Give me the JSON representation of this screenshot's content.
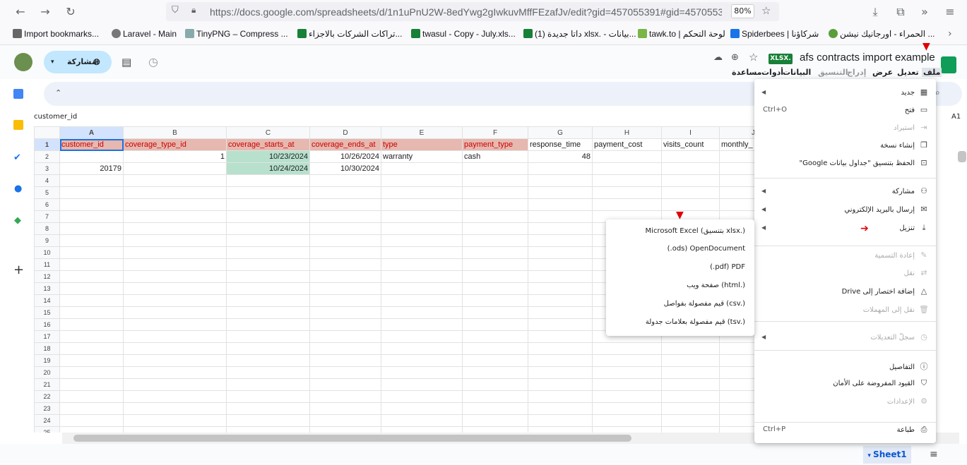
{
  "browser": {
    "url": "https://docs.google.com/spreadsheets/d/1n1uPnU2W-8edYwg2gIwkuvMffFEzafJv/edit?gid=457055391#gid=4570553",
    "zoom": "80%"
  },
  "bookmarks": [
    "Import bookmarks...",
    "Laravel - Main",
    "TinyPNG – Compress ...",
    "تراكات الشركات بالاجزاء...",
    "twasul - Copy - July.xls...",
    "داتا جديدة (1) xlsx. - بيانات...",
    "tawk.to | لوحة التحكم",
    "Spiderbees | شركاؤنا",
    "الحمراء - اورجانيك نيشن ..."
  ],
  "doc": {
    "title": "afs contracts import example",
    "badge": "XLSX.",
    "share_label": "مشاركة",
    "menus": [
      "ملف",
      "تعديل",
      "عرض",
      "إدراج",
      "التنسيق",
      "البيانات",
      "أدوات",
      "مساعدة"
    ]
  },
  "namebox": "customer_id",
  "cellref": "A1",
  "columns": [
    "A",
    "B",
    "C",
    "D",
    "E",
    "F",
    "G",
    "H",
    "I",
    "J"
  ],
  "rows": [
    [
      "customer_id",
      "coverage_type_id",
      "coverage_starts_at",
      "coverage_ends_at",
      "type",
      "payment_type",
      "response_time",
      "payment_cost",
      "visits_count",
      "monthly_"
    ],
    [
      "",
      "1",
      "10/23/2024",
      "10/26/2024",
      "warranty",
      "cash",
      "48",
      "",
      "",
      ""
    ],
    [
      "20179",
      "",
      "10/24/2024",
      "10/30/2024",
      "",
      "",
      "",
      "",
      "",
      ""
    ]
  ],
  "row_numbers": [
    "1",
    "2",
    "3",
    "4",
    "5",
    "6",
    "7",
    "8",
    "9",
    "10",
    "11",
    "12",
    "13",
    "14",
    "15",
    "16",
    "17",
    "18",
    "19",
    "20",
    "21",
    "22",
    "23",
    "24",
    "25"
  ],
  "file_menu": {
    "items": [
      {
        "label": "جديد",
        "shortcut": "",
        "arrow": true,
        "disabled": false,
        "icon": "new-icon"
      },
      {
        "label": "فتح",
        "shortcut": "Ctrl+O",
        "arrow": false,
        "disabled": false,
        "icon": "folder-icon"
      },
      {
        "label": "استيراد",
        "shortcut": "",
        "arrow": false,
        "disabled": true,
        "icon": "import-icon"
      },
      {
        "label": "إنشاء نسخة",
        "shortcut": "",
        "arrow": false,
        "disabled": false,
        "icon": "copy-icon"
      },
      {
        "label": "الحفظ بتنسيق \"جداول بيانات Google\"",
        "shortcut": "",
        "arrow": false,
        "disabled": false,
        "icon": "save-icon"
      },
      {
        "label": "مشاركة",
        "shortcut": "",
        "arrow": true,
        "disabled": false,
        "icon": "share-person-icon"
      },
      {
        "label": "إرسال بالبريد الإلكتروني",
        "shortcut": "",
        "arrow": true,
        "disabled": false,
        "icon": "mail-icon"
      },
      {
        "label": "تنزيل",
        "shortcut": "",
        "arrow": true,
        "disabled": false,
        "icon": "download-icon"
      },
      {
        "label": "إعادة التسمية",
        "shortcut": "",
        "arrow": false,
        "disabled": true,
        "icon": "pencil-icon"
      },
      {
        "label": "نقل",
        "shortcut": "",
        "arrow": false,
        "disabled": true,
        "icon": "move-icon"
      },
      {
        "label": "إضافة اختصار إلى Drive",
        "shortcut": "",
        "arrow": false,
        "disabled": false,
        "icon": "drive-shortcut-icon"
      },
      {
        "label": "نقل إلى المهملات",
        "shortcut": "",
        "arrow": false,
        "disabled": true,
        "icon": "trash-icon"
      },
      {
        "label": "سجلّ التعديلات",
        "shortcut": "",
        "arrow": true,
        "disabled": true,
        "icon": "history-icon"
      },
      {
        "label": "التفاصيل",
        "shortcut": "",
        "arrow": false,
        "disabled": false,
        "icon": "info-icon"
      },
      {
        "label": "القيود المفروضة على الأمان",
        "shortcut": "",
        "arrow": false,
        "disabled": false,
        "icon": "shield-icon"
      },
      {
        "label": "الإعدادات",
        "shortcut": "",
        "arrow": false,
        "disabled": true,
        "icon": "gear-icon"
      },
      {
        "label": "طباعة",
        "shortcut": "Ctrl+P",
        "arrow": false,
        "disabled": false,
        "icon": "print-icon"
      }
    ]
  },
  "download_submenu": [
    "Microsoft Excel (بتنسيق xlsx.)",
    "(.ods) OpenDocument",
    "(.pdf) PDF",
    "صفحة ويب (html.)",
    "قيم مفصولة بفواصل (csv.)",
    "قيم مفصولة بعلامات جدولة (tsv.)"
  ],
  "sheet_tab": "Sheet1"
}
